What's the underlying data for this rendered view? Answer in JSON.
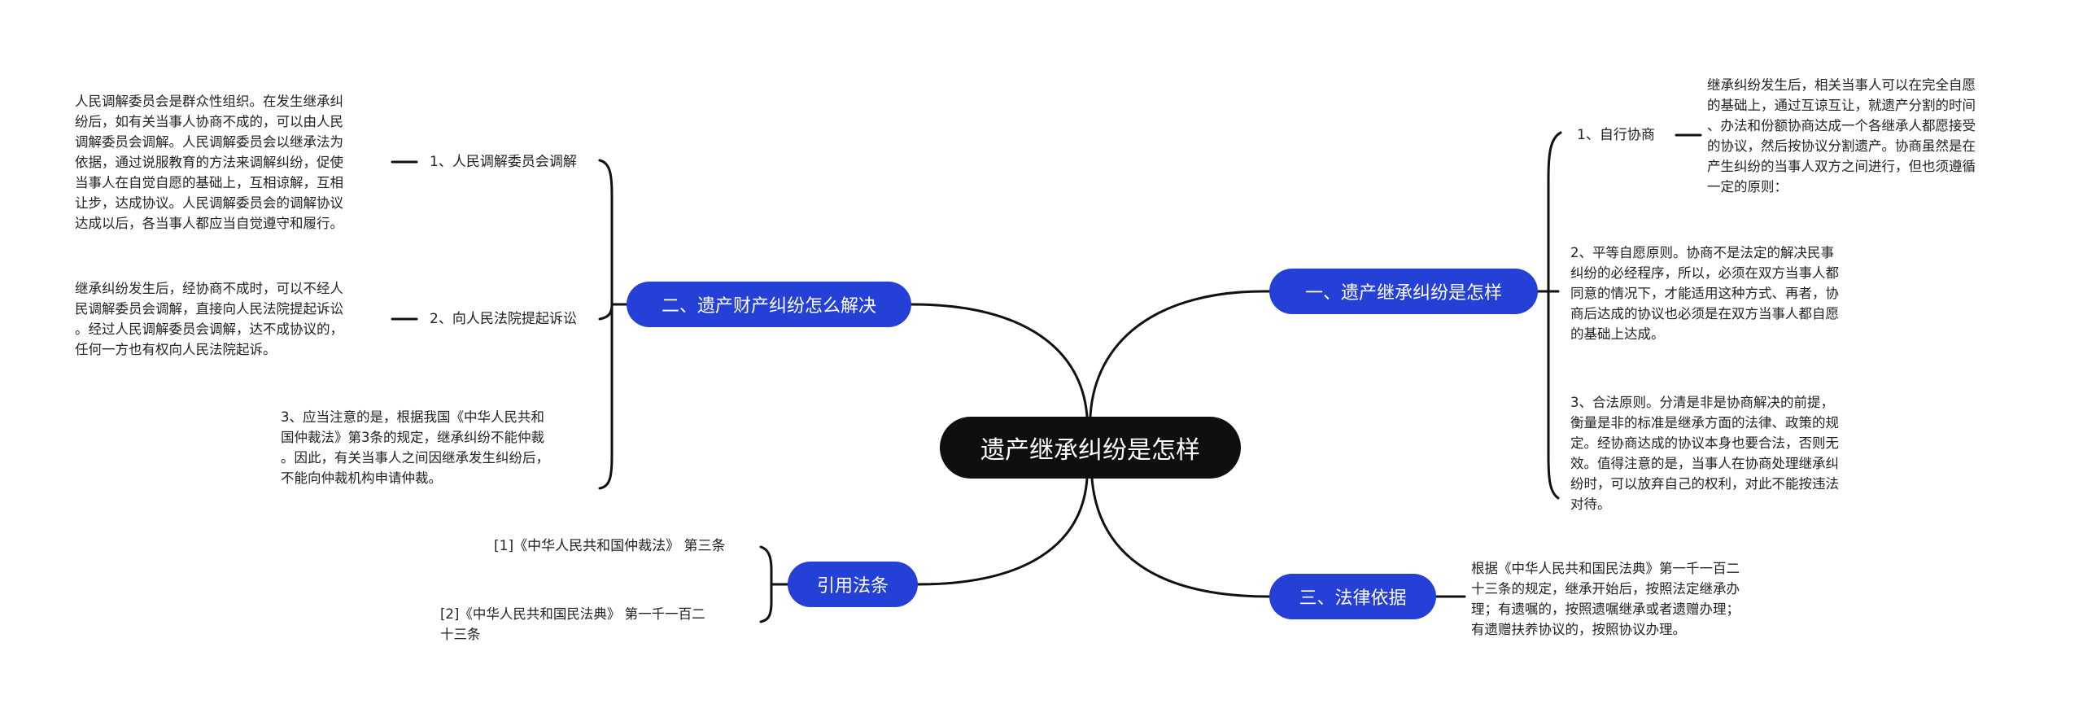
{
  "root": {
    "title": "遗产继承纠纷是怎样"
  },
  "colors": {
    "root_bg": "#0f0f0f",
    "branch_bg": "#2440d6",
    "edge": "#111111"
  },
  "branches": {
    "one": {
      "title": "一、遗产继承纠纷是怎样",
      "sub1_label": "1、自行协商",
      "sub1_text": "继承纠纷发生后，相关当事人可以在完全自愿\n的基础上，通过互谅互让，就遗产分割的时间\n、办法和份额协商达成一个各继承人都愿接受\n的协议，然后按协议分割遗产。协商虽然是在\n产生纠纷的当事人双方之间进行，但也须遵循\n一定的原则：",
      "item2": "2、平等自愿原则。协商不是法定的解决民事\n纠纷的必经程序，所以，必须在双方当事人都\n同意的情况下，才能适用这种方式、再者，协\n商后达成的协议也必须是在双方当事人都自愿\n的基础上达成。",
      "item3": "3、合法原则。分清是非是协商解决的前提，\n衡量是非的标准是继承方面的法律、政策的规\n定。经协商达成的协议本身也要合法，否则无\n效。值得注意的是，当事人在协商处理继承纠\n纷时，可以放弃自己的权利，对此不能按违法\n对待。"
    },
    "two": {
      "title": "二、遗产财产纠纷怎么解决",
      "sub1_label": "1、人民调解委员会调解",
      "sub1_text": "人民调解委员会是群众性组织。在发生继承纠\n纷后，如有关当事人协商不成的，可以由人民\n调解委员会调解。人民调解委员会以继承法为\n依据，通过说服教育的方法来调解纠纷，促使\n当事人在自觉自愿的基础上，互相谅解，互相\n让步，达成协议。人民调解委员会的调解协议\n达成以后，各当事人都应当自觉遵守和履行。",
      "sub2_label": "2、向人民法院提起诉讼",
      "sub2_text": "继承纠纷发生后，经协商不成时，可以不经人\n民调解委员会调解，直接向人民法院提起诉讼\n。经过人民调解委员会调解，达不成协议的，\n任何一方也有权向人民法院起诉。",
      "item3": "3、应当注意的是，根据我国《中华人民共和\n国仲裁法》第3条的规定，继承纠纷不能仲裁\n。因此，有关当事人之间因继承发生纠纷后，\n不能向仲裁机构申请仲裁。"
    },
    "three": {
      "title": "三、法律依据",
      "text": "根据《中华人民共和国民法典》第一千一百二\n十三条的规定，继承开始后，按照法定继承办\n理；有遗嘱的，按照遗嘱继承或者遗赠办理；\n有遗赠扶养协议的，按照协议办理。"
    },
    "four": {
      "title": "引用法条",
      "ref1": "[1]《中华人民共和国仲裁法》 第三条",
      "ref2": "[2]《中华人民共和国民法典》 第一千一百二\n十三条"
    }
  }
}
